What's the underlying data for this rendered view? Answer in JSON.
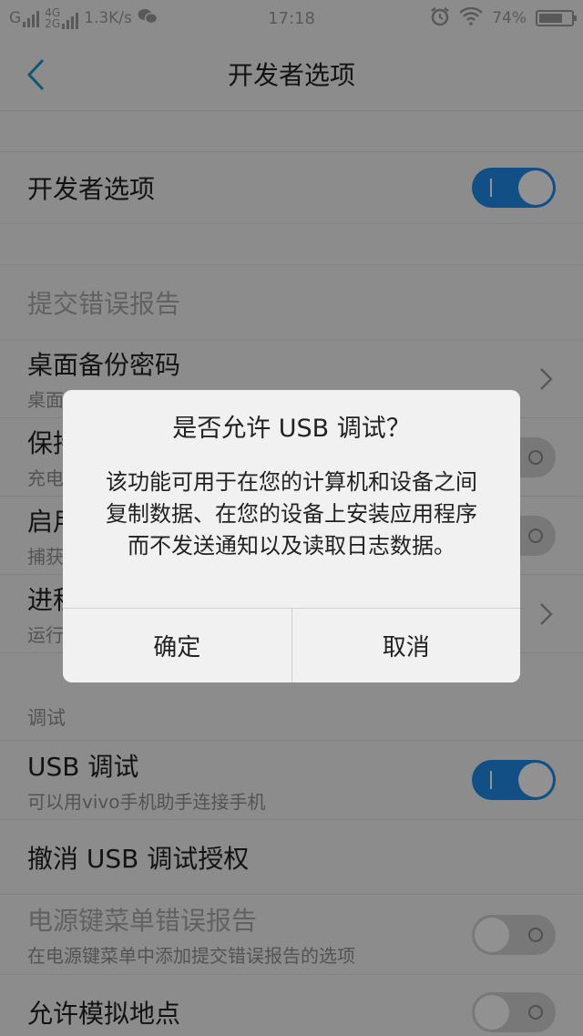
{
  "status_bar": {
    "signal1_label": "G",
    "net_top": "4G",
    "net_bottom": "2G",
    "speed": "1.3K/s",
    "time": "17:18",
    "battery": "74%",
    "battery_level": 0.74
  },
  "nav": {
    "title": "开发者选项"
  },
  "rows": {
    "dev_options": {
      "title": "开发者选项",
      "state": "on"
    },
    "bug_report": {
      "title": "提交错误报告"
    },
    "desktop_backup": {
      "title": "桌面备份密码",
      "sub": "桌面"
    },
    "stay_awake": {
      "title": "保持",
      "sub": "充电"
    },
    "bt_hci": {
      "title": "启用",
      "sub": "捕获"
    },
    "running_services": {
      "title": "进程",
      "sub": "运行"
    }
  },
  "debug_section": {
    "header": "调试",
    "usb_debug": {
      "title": "USB 调试",
      "sub": "可以用vivo手机助手连接手机",
      "state": "on"
    },
    "revoke_usb": {
      "title": "撤消 USB 调试授权"
    },
    "power_menu_bug": {
      "title": "电源键菜单错误报告",
      "sub": "在电源键菜单中添加提交错误报告的选项",
      "state": "off"
    },
    "mock_location": {
      "title": "允许模拟地点",
      "state": "off"
    }
  },
  "dialog": {
    "title": "是否允许 USB 调试？",
    "message": "该功能可用于在您的计算机和设备之间复制数据、在您的设备上安装应用程序而不发送通知以及读取日志数据。",
    "ok": "确定",
    "cancel": "取消"
  },
  "colors": {
    "accent": "#1e88e5"
  }
}
